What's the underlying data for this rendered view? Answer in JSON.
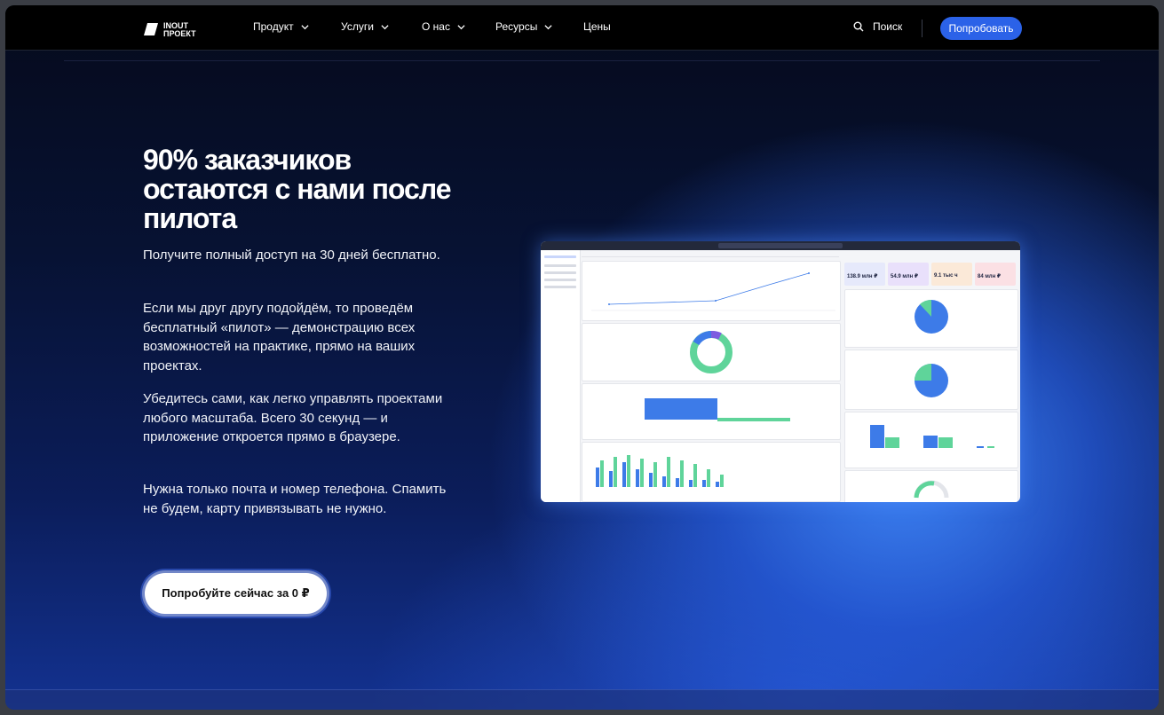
{
  "nav": {
    "logo_text": [
      "INOUT",
      "ПРОЕКТ"
    ],
    "items": [
      {
        "label": "Продукт",
        "has_dropdown": true
      },
      {
        "label": "Услуги",
        "has_dropdown": true
      },
      {
        "label": "О нас",
        "has_dropdown": true
      },
      {
        "label": "Ресурсы",
        "has_dropdown": true
      },
      {
        "label": "Цены",
        "has_dropdown": false
      }
    ],
    "search_label": "Поиск",
    "cta_label": "Попробовать"
  },
  "hero": {
    "headline": "90% заказчиков остаются с нами после пилота",
    "paragraphs": [
      "Получите полный доступ на 30 дней бесплатно.",
      "Если мы друг другу подойдём, то проведём бесплатный «пилот» — демонстрацию всех возможностей на практике, прямо на ваших проектах.",
      "Убедитесь сами, как легко управлять проектами любого масштаба. Всего 30 секунд — и приложение откроется прямо в браузере.",
      "Нужна только почта и номер телефона. Спамить не будем, карту привязывать не нужно."
    ],
    "cta_label": "Попробуйте сейчас за 0 ₽"
  },
  "dashboard_preview": {
    "kpis": [
      {
        "value": "138.9 млн ₽",
        "color": "#e6e9fb"
      },
      {
        "value": "54.9 млн ₽",
        "color": "#e9e0fb"
      },
      {
        "value": "9.1 тыс ч",
        "color": "#fbe9d8"
      },
      {
        "value": "84 млн ₽",
        "color": "#fbe0e4"
      }
    ],
    "colors": {
      "blue": "#3d7be8",
      "green": "#5fd49a",
      "navy": "#23293b"
    }
  },
  "colors": {
    "accent": "#2b62e8",
    "nav_bg": "#000000",
    "text": "#ffffff"
  }
}
